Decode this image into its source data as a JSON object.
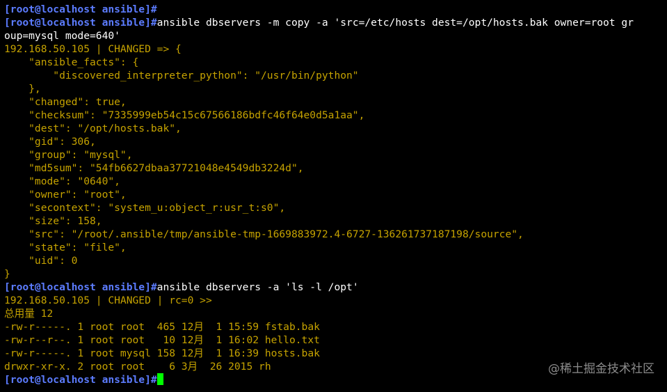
{
  "terminal": {
    "prompt": "[root@localhost ansible]#",
    "lines": [
      {
        "type": "prompt",
        "cmd": ""
      },
      {
        "type": "prompt",
        "cmd": "ansible dbservers -m copy -a 'src=/etc/hosts dest=/opt/hosts.bak owner=root gr"
      },
      {
        "type": "cmd",
        "text": "oup=mysql mode=640'"
      },
      {
        "type": "out",
        "text": "192.168.50.105 | CHANGED => {"
      },
      {
        "type": "out",
        "text": "    \"ansible_facts\": {"
      },
      {
        "type": "out",
        "text": "        \"discovered_interpreter_python\": \"/usr/bin/python\""
      },
      {
        "type": "out",
        "text": "    },"
      },
      {
        "type": "out",
        "text": "    \"changed\": true,"
      },
      {
        "type": "out",
        "text": "    \"checksum\": \"7335999eb54c15c67566186bdfc46f64e0d5a1aa\","
      },
      {
        "type": "out",
        "text": "    \"dest\": \"/opt/hosts.bak\","
      },
      {
        "type": "out",
        "text": "    \"gid\": 306,"
      },
      {
        "type": "out",
        "text": "    \"group\": \"mysql\","
      },
      {
        "type": "out",
        "text": "    \"md5sum\": \"54fb6627dbaa37721048e4549db3224d\","
      },
      {
        "type": "out",
        "text": "    \"mode\": \"0640\","
      },
      {
        "type": "out",
        "text": "    \"owner\": \"root\","
      },
      {
        "type": "out",
        "text": "    \"secontext\": \"system_u:object_r:usr_t:s0\","
      },
      {
        "type": "out",
        "text": "    \"size\": 158,"
      },
      {
        "type": "out",
        "text": "    \"src\": \"/root/.ansible/tmp/ansible-tmp-1669883972.4-6727-136261737187198/source\","
      },
      {
        "type": "out",
        "text": "    \"state\": \"file\","
      },
      {
        "type": "out",
        "text": "    \"uid\": 0"
      },
      {
        "type": "out",
        "text": "}"
      },
      {
        "type": "prompt",
        "cmd": "ansible dbservers -a 'ls -l /opt'"
      },
      {
        "type": "out",
        "text": "192.168.50.105 | CHANGED | rc=0 >>"
      },
      {
        "type": "out",
        "text": "总用量 12"
      },
      {
        "type": "out",
        "text": "-rw-r-----. 1 root root  465 12月  1 15:59 fstab.bak"
      },
      {
        "type": "out",
        "text": "-rw-r--r--. 1 root root   10 12月  1 16:02 hello.txt"
      },
      {
        "type": "out",
        "text": "-rw-r-----. 1 root mysql 158 12月  1 16:39 hosts.bak"
      },
      {
        "type": "out",
        "text": "drwxr-xr-x. 2 root root    6 3月  26 2015 rh"
      },
      {
        "type": "prompt",
        "cmd": "",
        "cursor": true
      }
    ]
  },
  "watermark": "@稀土掘金技术社区",
  "colors": {
    "background": "#000000",
    "prompt": "#5c7cff",
    "command": "#ffffff",
    "output": "#c6a300",
    "cursor": "#00ff00",
    "watermark": "#8c8c8c"
  }
}
